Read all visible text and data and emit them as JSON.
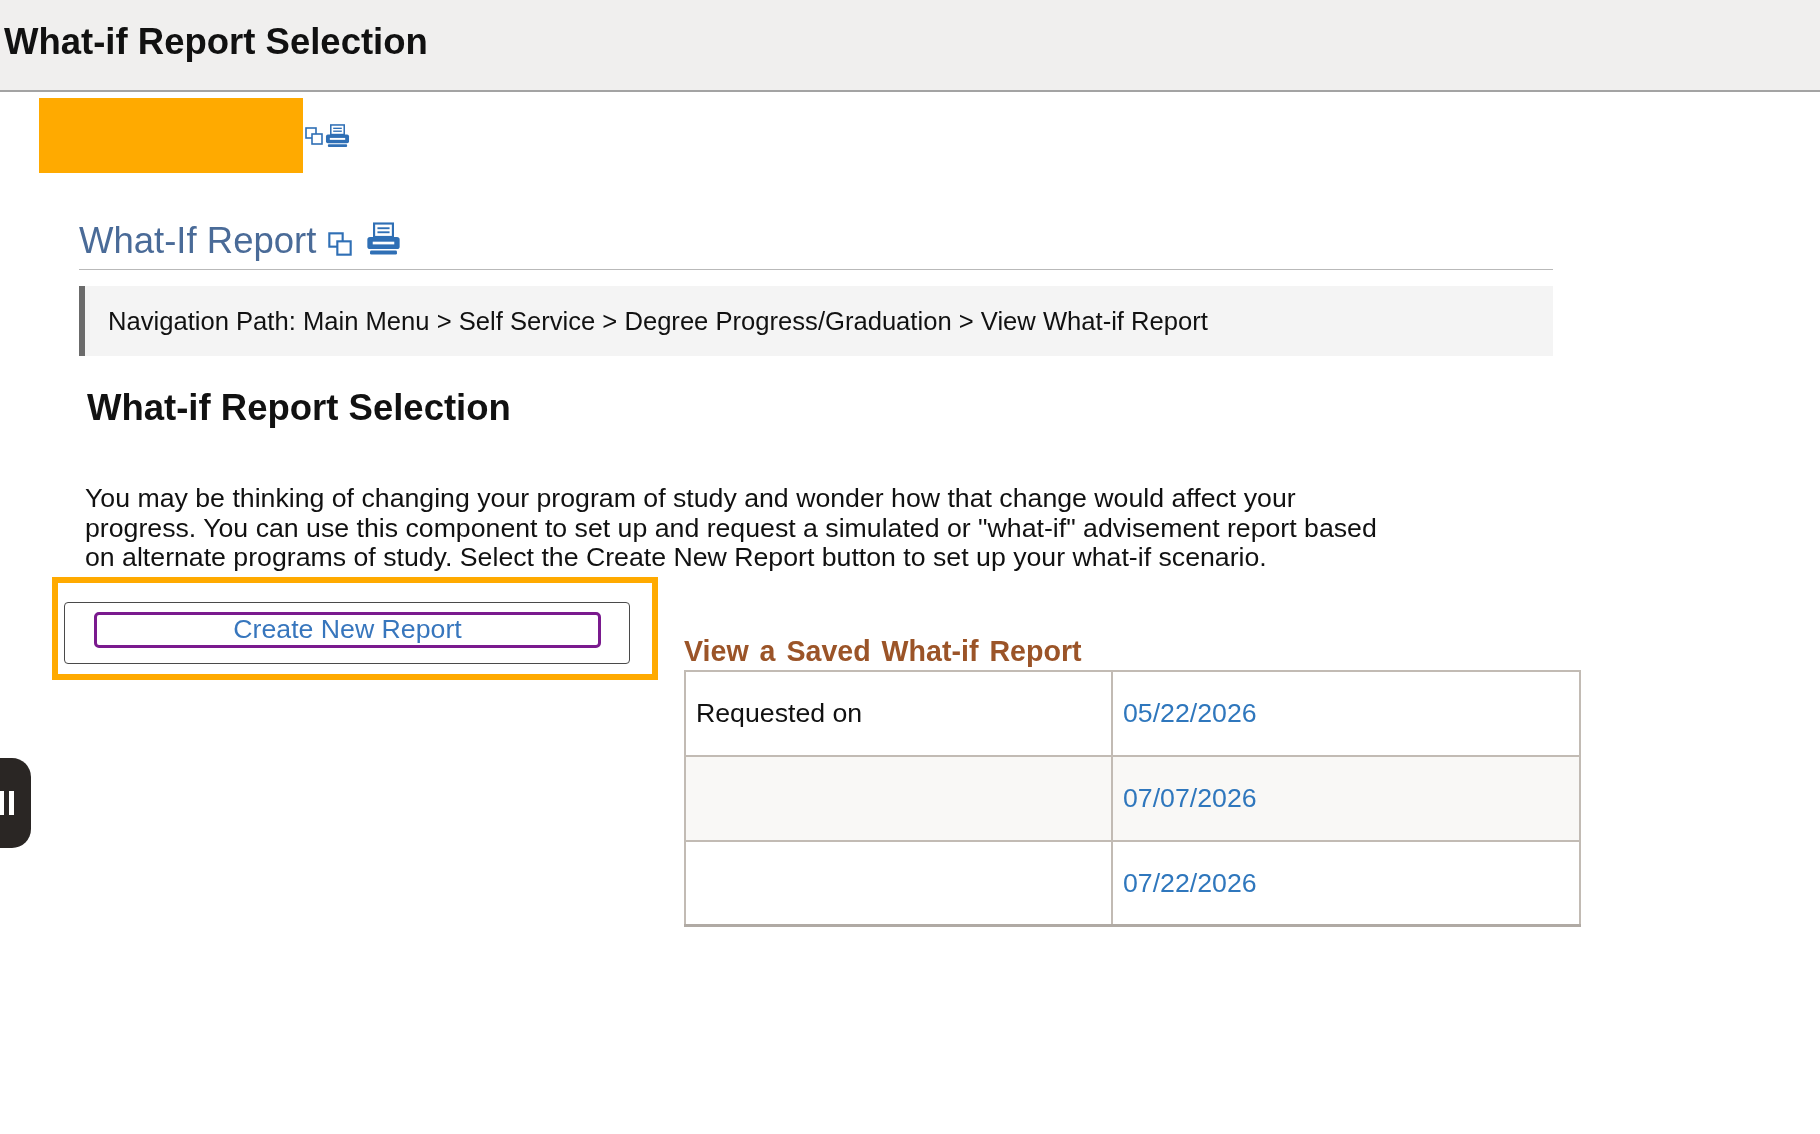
{
  "header": {
    "title": "What-if Report Selection"
  },
  "report": {
    "heading": "What-If Report",
    "navigation_path": "Navigation Path: Main Menu > Self Service > Degree Progress/Graduation > View What-if Report",
    "section_title": "What-if Report Selection",
    "description": "You may be thinking of changing your program of study and wonder how that change would affect your progress. You can use this component to set up and request a simulated or \"what-if\" advisement report based on alternate programs of study. Select the Create New Report button to set up your what-if scenario.",
    "create_button": {
      "label": "Create New Report",
      "focused": true,
      "highlighted": true
    }
  },
  "saved_reports": {
    "title": "View a Saved What-if Report",
    "rows": [
      {
        "label": "Requested on",
        "date": "05/22/2026"
      },
      {
        "date": "07/07/2026"
      },
      {
        "date": "07/22/2026"
      }
    ]
  }
}
